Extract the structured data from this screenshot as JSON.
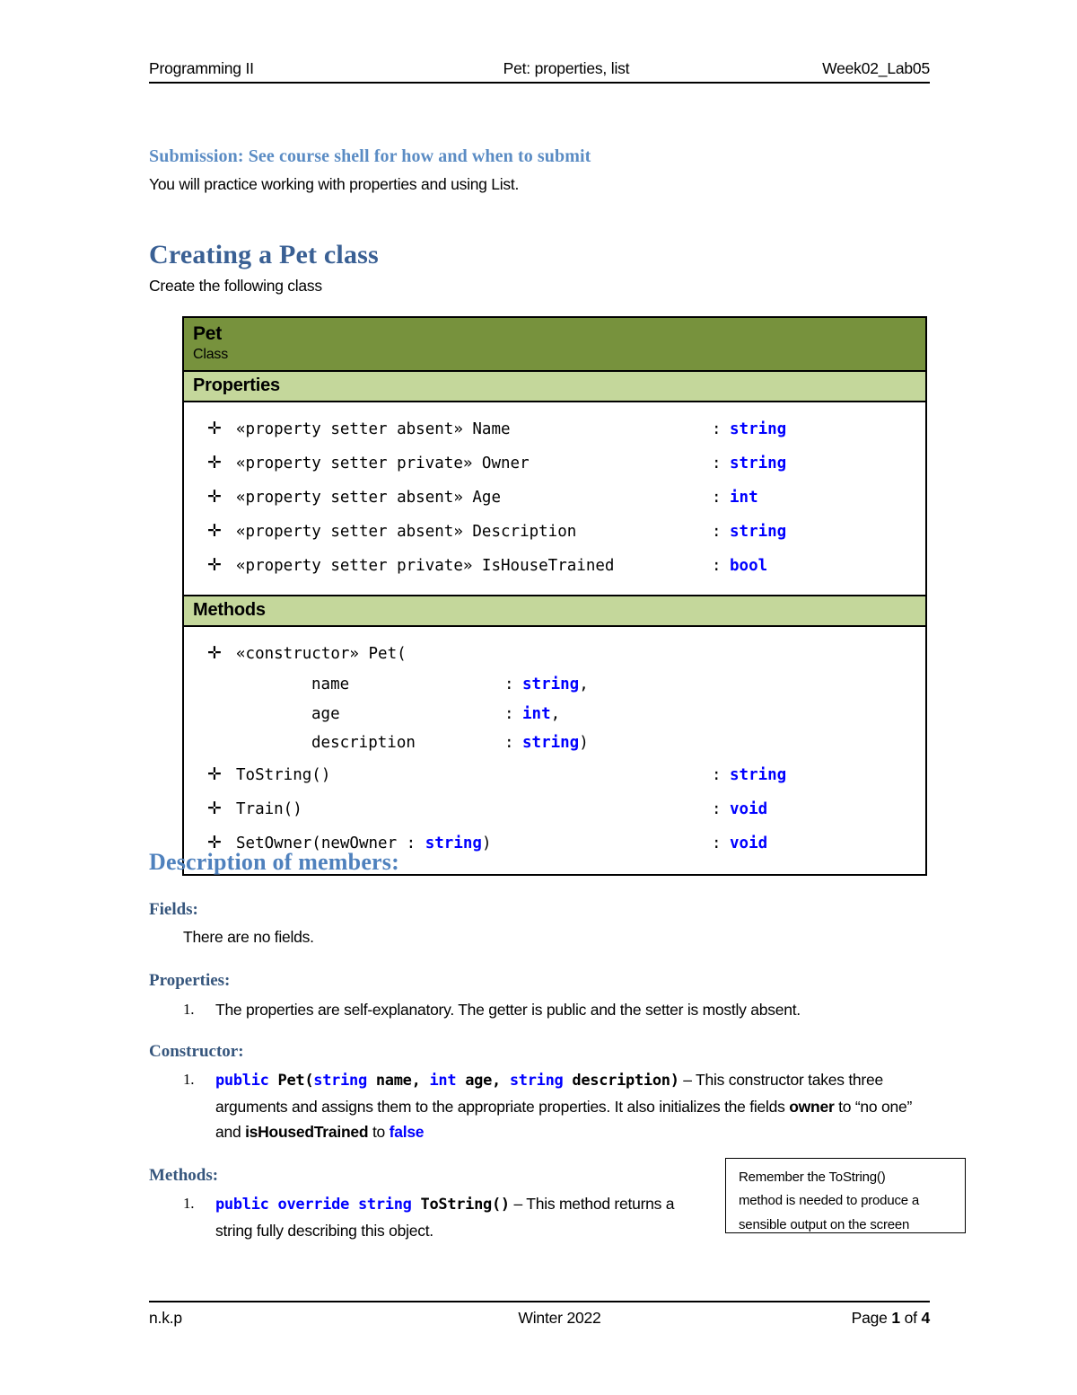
{
  "header": {
    "left": "Programming II",
    "center": "Pet: properties, list",
    "right": "Week02_Lab05"
  },
  "footer": {
    "left": "n.k.p",
    "center": "Winter 2022",
    "page_prefix": "Page ",
    "page_number": "1",
    "page_mid": " of ",
    "page_total": "4"
  },
  "intro": {
    "submission_heading": "Submission: See course shell for how and when to submit",
    "submission_text": "You will practice working with properties and using List."
  },
  "creating": {
    "heading": "Creating a Pet class",
    "text": "Create the following class"
  },
  "class_diagram": {
    "title": "Pet",
    "stereotype": "Class",
    "properties_band": "Properties",
    "methods_band": "Methods",
    "visibility_marker": "✛",
    "colon": ":",
    "colors": {
      "title_bar": "#77923D",
      "band": "#C4D79B",
      "type_text": "#0000FF",
      "border": "#000000"
    },
    "properties": [
      {
        "signature": "«property setter absent» Name",
        "type": "string"
      },
      {
        "signature": "«property setter private» Owner",
        "type": "string"
      },
      {
        "signature": "«property setter absent» Age",
        "type": "int"
      },
      {
        "signature": "«property setter absent» Description",
        "type": "string"
      },
      {
        "signature": "«property setter private» IsHouseTrained",
        "type": "bool"
      }
    ],
    "constructor": {
      "signature": "«constructor» Pet(",
      "params": [
        {
          "name": "name",
          "type": "string",
          "suffix": ","
        },
        {
          "name": "age",
          "type": "int",
          "suffix": ","
        },
        {
          "name": "description",
          "type": "string",
          "suffix": ")"
        }
      ]
    },
    "methods": [
      {
        "signature": "ToString()",
        "type": "string"
      },
      {
        "signature": "Train()",
        "type": "void"
      },
      {
        "signature": "SetOwner(newOwner : ",
        "type": "string",
        "signature_tail": ")",
        "split": true,
        "full": "SetOwner(newOwner : string)"
      }
    ],
    "method_types": [
      "string",
      "void",
      "void"
    ]
  },
  "description": {
    "heading": "Description of members:",
    "fields": {
      "heading": "Fields:",
      "text": "There are no fields."
    },
    "properties": {
      "heading": "Properties:",
      "item_number": "1.",
      "item_text": "The properties are self-explanatory. The getter is public and the setter is mostly absent."
    },
    "constructor": {
      "heading": "Constructor:",
      "item_number": "1.",
      "code_public": "public",
      "code_pet": " Pet(",
      "code_string1": "string",
      "code_name": " name, ",
      "code_int": "int",
      "code_age": " age, ",
      "code_string2": "string",
      "code_description": " description)",
      "dash": " – ",
      "text_part1": "This constructor takes three arguments and assigns them to the appropriate properties. It also initializes the fields ",
      "field_owner": "owner",
      "text_part2": " to “no one” and ",
      "field_ishoused": "isHousedTrained",
      "text_part3": " to ",
      "value_false": "false"
    },
    "methods": {
      "heading": "Methods:",
      "item_number": "1.",
      "code_public": "public override string",
      "code_tostring": " ToString()",
      "dash": " – ",
      "text": "This method returns a string fully describing this object."
    }
  },
  "callout": {
    "line1": "Remember the ToString()",
    "line2": "method is needed to produce a",
    "line3": "sensible output on the screen"
  }
}
